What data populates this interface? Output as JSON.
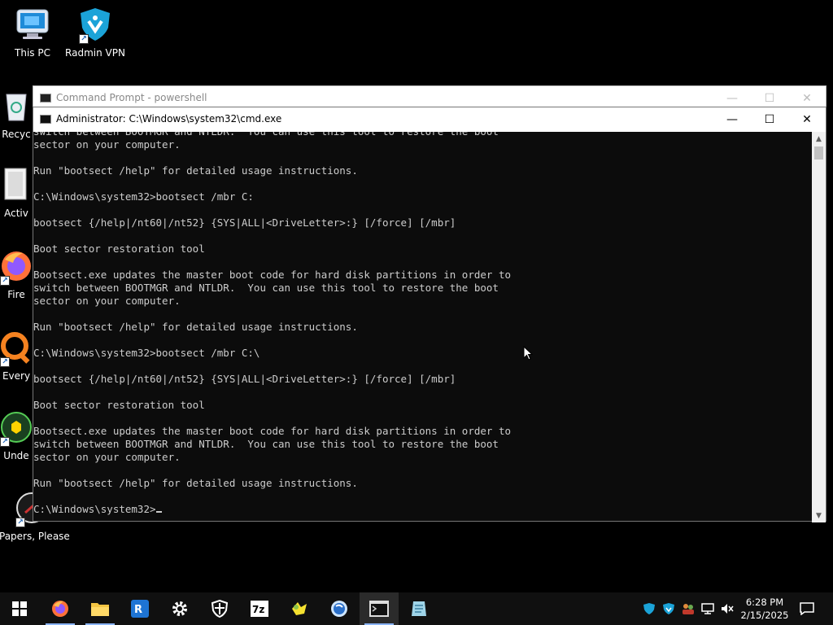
{
  "desktop": {
    "icons": [
      {
        "name": "This PC",
        "label": "This PC"
      },
      {
        "name": "Radmin VPN",
        "label": "Radmin VPN"
      },
      {
        "name": "Recycle Bin",
        "label": "Recyc"
      },
      {
        "name": "Activate",
        "label": "Activ"
      },
      {
        "name": "Firefox",
        "label": "Fire"
      },
      {
        "name": "Everything",
        "label": "Every"
      },
      {
        "name": "Undertale",
        "label": "Unde"
      },
      {
        "name": "Papers, Please",
        "label": "Papers, Please"
      }
    ]
  },
  "windows": {
    "back": {
      "title": "Command Prompt - powershell"
    },
    "front": {
      "title": "Administrator: C:\\Windows\\system32\\cmd.exe",
      "console_lines": [
        "switch between BOOTMGR and NTLDR.  You can use this tool to restore the boot",
        "sector on your computer.",
        "",
        "Run \"bootsect /help\" for detailed usage instructions.",
        "",
        "C:\\Windows\\system32>bootsect /mbr C:",
        "",
        "bootsect {/help|/nt60|/nt52} {SYS|ALL|<DriveLetter>:} [/force] [/mbr]",
        "",
        "Boot sector restoration tool",
        "",
        "Bootsect.exe updates the master boot code for hard disk partitions in order to",
        "switch between BOOTMGR and NTLDR.  You can use this tool to restore the boot",
        "sector on your computer.",
        "",
        "Run \"bootsect /help\" for detailed usage instructions.",
        "",
        "C:\\Windows\\system32>bootsect /mbr C:\\",
        "",
        "bootsect {/help|/nt60|/nt52} {SYS|ALL|<DriveLetter>:} [/force] [/mbr]",
        "",
        "Boot sector restoration tool",
        "",
        "Bootsect.exe updates the master boot code for hard disk partitions in order to",
        "switch between BOOTMGR and NTLDR.  You can use this tool to restore the boot",
        "sector on your computer.",
        "",
        "Run \"bootsect /help\" for detailed usage instructions.",
        ""
      ],
      "prompt": "C:\\Windows\\system32>"
    }
  },
  "taskbar": {
    "apps": [
      "start-icon",
      "firefox-icon",
      "file-explorer-icon",
      "remote-desktop-icon",
      "settings-icon",
      "security-icon",
      "7zip-icon",
      "app-yellow-icon",
      "app-blue-globe-icon",
      "cmd-icon",
      "notepad-icon"
    ],
    "active_app": "cmd-icon",
    "clock": {
      "time": "6:28 PM",
      "date": "2/15/2025"
    }
  },
  "colors": {
    "console_bg": "#0c0c0c",
    "console_fg": "#cccccc",
    "taskbar_bg": "#101010"
  }
}
